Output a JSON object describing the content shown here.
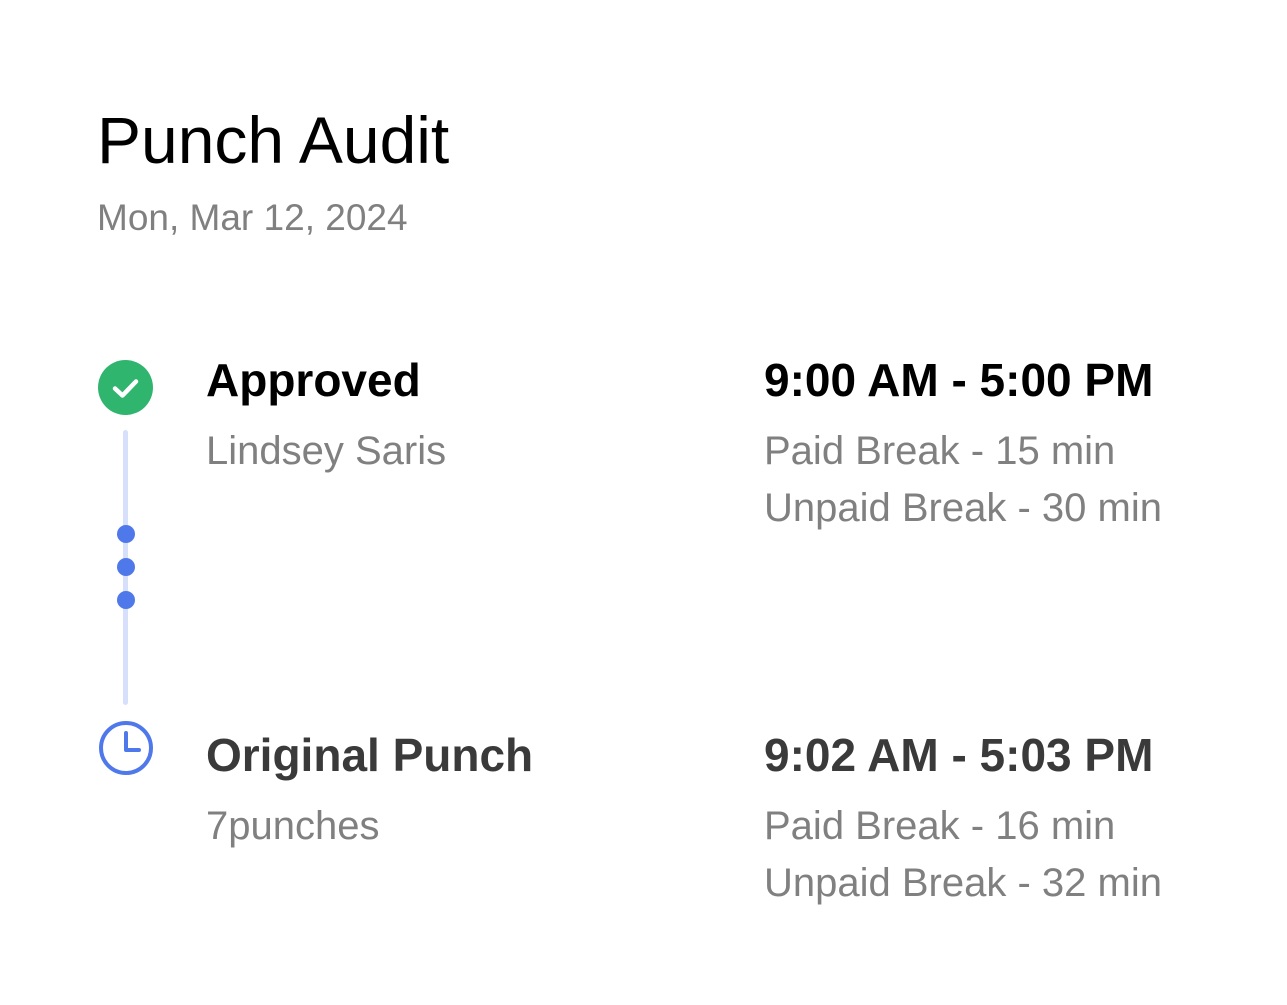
{
  "header": {
    "title": "Punch Audit",
    "date": "Mon, Mar 12, 2024"
  },
  "colors": {
    "approved_green": "#2fb56e",
    "timeline_blue": "#4f78ea",
    "timeline_line": "#d6e0fb"
  },
  "entries": [
    {
      "icon": "check-circle-icon",
      "status": "Approved",
      "subtitle": "Lindsey Saris",
      "time_range": "9:00 AM - 5:00 PM",
      "paid_break": "Paid Break - 15 min",
      "unpaid_break": "Unpaid Break - 30 min"
    },
    {
      "icon": "clock-icon",
      "status": "Original Punch",
      "subtitle": "7punches",
      "time_range": "9:02 AM - 5:03 PM",
      "paid_break": "Paid Break - 16 min",
      "unpaid_break": "Unpaid Break - 32 min"
    }
  ]
}
